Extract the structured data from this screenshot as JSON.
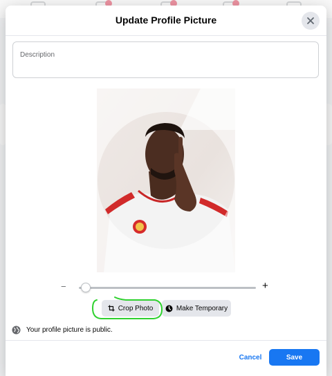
{
  "modal": {
    "title": "Update Profile Picture",
    "description_placeholder": "Description",
    "crop_label": "Crop Photo",
    "temporary_label": "Make Temporary",
    "privacy_text": "Your profile picture is public.",
    "cancel_label": "Cancel",
    "save_label": "Save",
    "zoom_minus": "−",
    "zoom_plus": "+",
    "zoom_level": 0.04
  },
  "colors": {
    "accent": "#1877f2",
    "annotation": "#2fd12f",
    "button_gray": "#e4e6eb"
  },
  "icons": {
    "close": "close-icon",
    "crop": "crop-icon",
    "clock": "clock-icon",
    "globe": "globe-icon"
  }
}
